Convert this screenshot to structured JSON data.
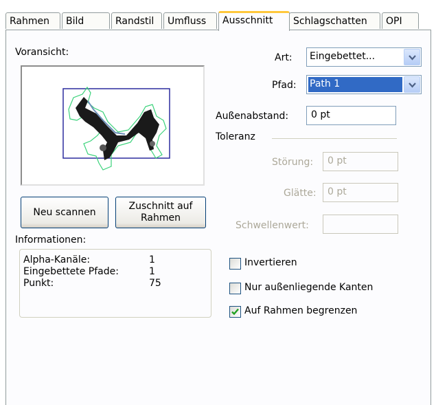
{
  "tabs": [
    {
      "label": "Rahmen"
    },
    {
      "label": "Bild"
    },
    {
      "label": "Randstil"
    },
    {
      "label": "Umfluss"
    },
    {
      "label": "Ausschnitt"
    },
    {
      "label": "Schlagschatten"
    },
    {
      "label": "OPI"
    }
  ],
  "preview": {
    "label": "Voransicht:"
  },
  "buttons": {
    "rescan": "Neu scannen",
    "crop_line1": "Zuschnitt auf",
    "crop_line2": "Rahmen"
  },
  "info": {
    "title": "Informationen:",
    "rows": [
      {
        "label": "Alpha-Kanäle:",
        "value": "1"
      },
      {
        "label": "Eingebettete Pfade:",
        "value": "1"
      },
      {
        "label": "Punkt:",
        "value": "75"
      }
    ]
  },
  "art": {
    "label": "Art:",
    "value": "Eingebettet..."
  },
  "pfad": {
    "label": "Pfad:",
    "value": "Path 1"
  },
  "abstand": {
    "label": "Außenabstand:",
    "value": "0 pt"
  },
  "toleranz": {
    "title": "Toleranz",
    "stoerung_label": "Störung:",
    "stoerung_value": "0 pt",
    "glaette_label": "Glätte:",
    "glaette_value": "0 pt",
    "schwelle_label": "Schwellenwert:",
    "schwelle_value": ""
  },
  "options": {
    "invert": {
      "label": "Invertieren",
      "checked": false
    },
    "outer": {
      "label": "Nur außenliegende Kanten",
      "checked": false
    },
    "limit": {
      "label": "Auf Rahmen begrenzen",
      "checked": true
    }
  },
  "colors": {
    "active_tab": "#ffc83c",
    "selection": "#316ac5",
    "path_green": "#3ad27a",
    "frame_blue": "#2b2b9e"
  }
}
